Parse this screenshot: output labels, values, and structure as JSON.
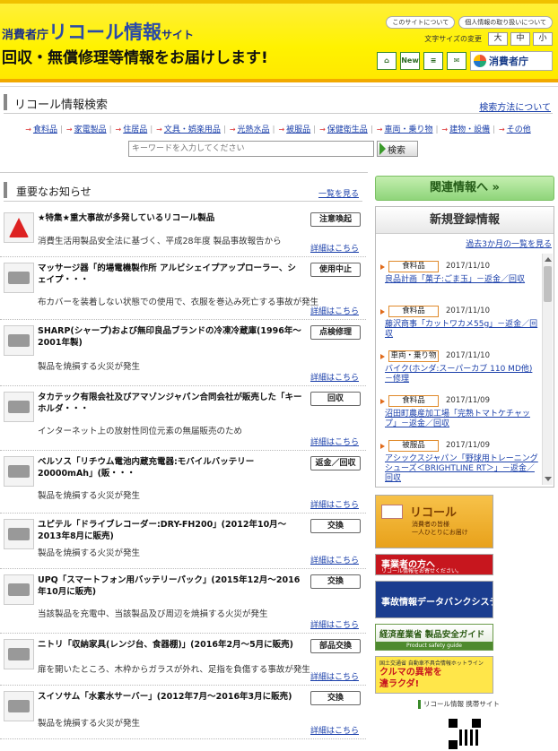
{
  "header": {
    "title_prefix": "消費者庁",
    "title_main": "リコール情報",
    "title_suffix": "サイト",
    "tagline": "回収・無償修理等情報をお届けします!",
    "top_links": [
      "このサイトについて",
      "個人情報の取り扱いについて"
    ],
    "font_size_label": "文字サイズの変更",
    "font_sizes": [
      "大",
      "中",
      "小"
    ],
    "icons": [
      "home-icon",
      "new-icon",
      "list-icon",
      "mail-icon"
    ],
    "new_label": "New",
    "agency_logo": "消費者庁"
  },
  "search": {
    "title": "リコール情報検索",
    "help_link": "検索方法について",
    "categories": [
      "食料品",
      "家電製品",
      "住居品",
      "文具・娯楽用品",
      "光熱水品",
      "被服品",
      "保健衛生品",
      "車両・乗り物",
      "建物・設備",
      "その他"
    ],
    "placeholder": "キーワードを入力してください",
    "button": "検索"
  },
  "news": {
    "title": "重要なお知らせ",
    "more_link": "一覧を見る",
    "detail_label": "詳細はこちら",
    "items": [
      {
        "title": "★特集★重大事故が多発しているリコール製品",
        "badge": "注意喚起",
        "desc": "消費生活用製品安全法に基づく、平成28年度 製品事故報告から"
      },
      {
        "title": "マッサージ器「的場電機製作所 アルビシェイプアップローラー、シェイプ・・・",
        "badge": "使用中止",
        "desc": "布カバーを装着しない状態での使用で、衣服を巻込み死亡する事故が発生"
      },
      {
        "title": "SHARP(シャープ)および無印良品ブランドの冷凍冷蔵庫(1996年〜2001年製)",
        "badge": "点検修理",
        "desc": "製品を焼損する火災が発生"
      },
      {
        "title": "タカテック有限会社及びアマゾンジャパン合同会社が販売した「キーホルダ・・・",
        "badge": "回収",
        "desc": "インターネット上の放射性同位元素の無届販売のため"
      },
      {
        "title": "ベルソス「リチウム電池内蔵充電器:モバイルバッテリー 20000mAh」(販・・・",
        "badge": "返金／回収",
        "desc": "製品を焼損する火災が発生"
      },
      {
        "title": "ユピテル「ドライブレコーダー:DRY-FH200」(2012年10月〜2013年8月に販売)",
        "badge": "交換",
        "desc": "製品を焼損する火災が発生"
      },
      {
        "title": "UPQ「スマートフォン用バッテリーパック」(2015年12月〜2016年10月に販売)",
        "badge": "交換",
        "desc": "当該製品を充電中、当該製品及び周辺を焼損する火災が発生"
      },
      {
        "title": "ニトリ「収納家具(レンジ台、食器棚)」(2016年2月〜5月に販売)",
        "badge": "部品交換",
        "desc": "扉を開いたところ、木枠からガラスが外れ、足指を負傷する事故が発生"
      },
      {
        "title": "スイソサム「水素水サーバー」(2012年7月〜2016年3月に販売)",
        "badge": "交換",
        "desc": "製品を焼損する火災が発生"
      }
    ]
  },
  "sidebar": {
    "related_button": "関連情報へ",
    "new_title": "新規登録情報",
    "past_link": "過去3か月の一覧を見る",
    "registrations": [
      {
        "category": "食料品",
        "date": "2017/11/10",
        "title": "良品計画「菓子:ごま玉」－返金／回収"
      },
      {
        "category": "食料品",
        "date": "2017/11/10",
        "title": "藤沢商事「カットワカメ55g」－返金／回収"
      },
      {
        "category": "車両・乗り物",
        "date": "2017/11/10",
        "title": "バイク(ホンダ:スーパーカブ 110 MD他)－修理"
      },
      {
        "category": "食料品",
        "date": "2017/11/09",
        "title": "沼田町農産加工場「完熟トマトケチャップ」－返金／回収"
      },
      {
        "category": "被服品",
        "date": "2017/11/09",
        "title": "アシックスジャパン「野球用トレーニングシューズ＜BRIGHTLINE RT＞」－返金／回収"
      }
    ],
    "banners": {
      "recall_mail_title": "リコール",
      "recall_mail_sub": "消費者の皆様\n一人ひとりにお届け",
      "business_title": "事業者の方へ",
      "business_sub": "リコール情報をお寄せください。",
      "databank": "事故情報データバンクシステム",
      "meti_title": "経済産業省 製品安全ガイド",
      "meti_sub": "Product safety guide",
      "mlit_sub": "国土交通省 自動車不具合情報ホットライン",
      "mlit_title": "クルマの異常を\n違ラクダ!",
      "recall_info": "リコール情報 携帯サイト"
    }
  }
}
